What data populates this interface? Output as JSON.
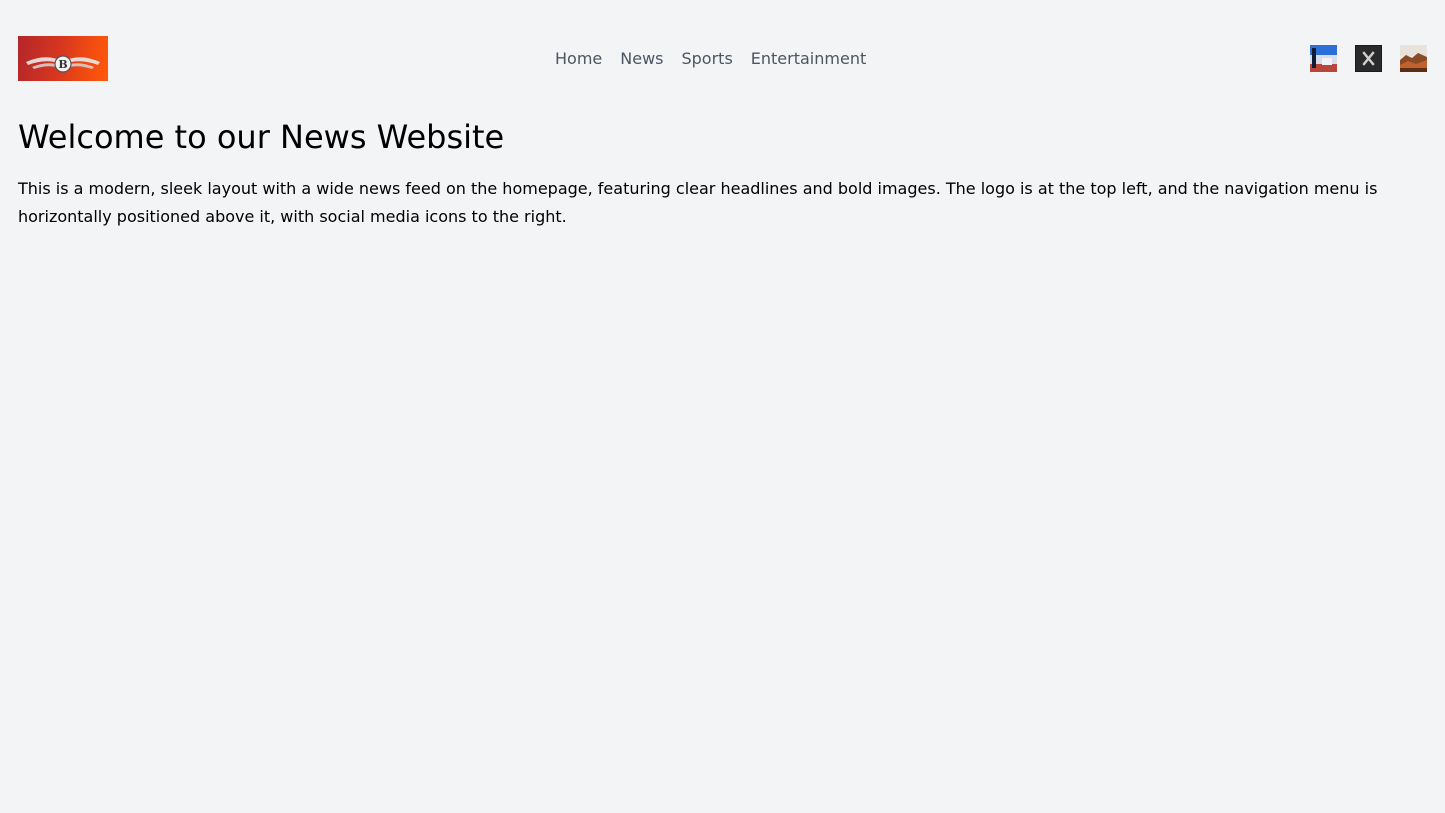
{
  "header": {
    "logo": {
      "icon": "winged-b-logo-icon",
      "colors": [
        "#b3262a",
        "#f04a12"
      ]
    },
    "nav": {
      "items": [
        {
          "label": "Home"
        },
        {
          "label": "News"
        },
        {
          "label": "Sports"
        },
        {
          "label": "Entertainment"
        }
      ]
    },
    "social": {
      "icons": [
        "social-photo-icon-1",
        "social-x-icon",
        "social-photo-icon-3"
      ]
    }
  },
  "main": {
    "title": "Welcome to our News Website",
    "intro": "This is a modern, sleek layout with a wide news feed on the homepage, featuring clear headlines and bold images. The logo is at the top left, and the navigation menu is horizontally positioned above it, with social media icons to the right."
  },
  "colors": {
    "background": "#f3f4f6",
    "nav_text": "#4b5563",
    "text": "#000000"
  }
}
